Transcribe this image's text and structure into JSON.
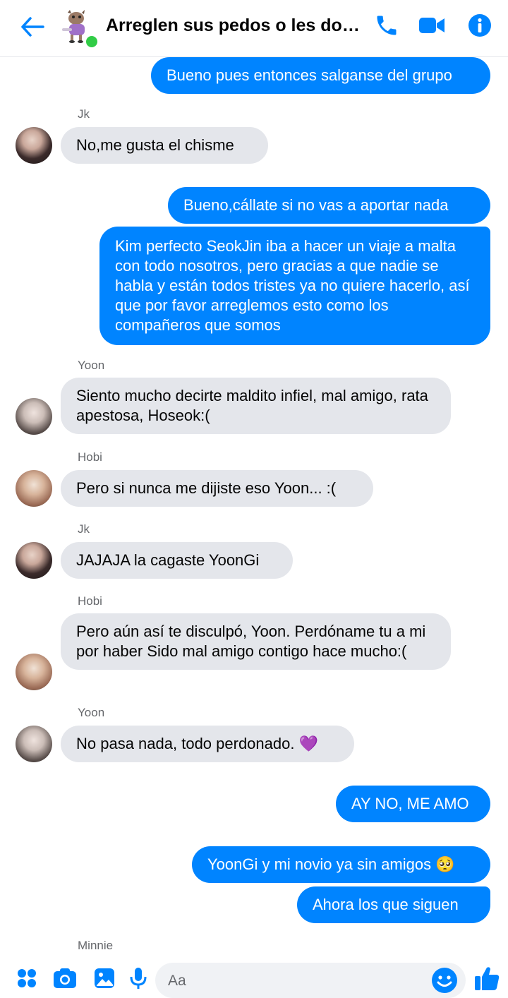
{
  "header": {
    "title": "Arreglen sus pedos o les doy en...",
    "back_icon": "arrow-left-icon",
    "call_icon": "phone-icon",
    "video_icon": "video-camera-icon",
    "info_icon": "info-icon",
    "accent": "#0084ff",
    "online_color": "#31cc46"
  },
  "messages": [
    {
      "dir": "out",
      "text": "Bueno pues entonces salganse del grupo"
    },
    {
      "dir": "in",
      "sender": "Jk",
      "text": "No,me gusta el chisme"
    },
    {
      "dir": "out",
      "text": "Bueno,cállate si no vas a aportar nada"
    },
    {
      "dir": "out",
      "text": "Kim perfecto SeokJin iba a hacer un viaje a malta con todo nosotros, pero gracias a que nadie se habla y están todos tristes ya no quiere hacerlo, así que por favor arreglemos esto como los compañeros que somos"
    },
    {
      "dir": "in",
      "sender": "Yoon",
      "text": "Siento mucho decirte maldito infiel, mal amigo, rata apestosa, Hoseok:("
    },
    {
      "dir": "in",
      "sender": "Hobi",
      "text": "Pero si nunca me dijiste eso Yoon... :("
    },
    {
      "dir": "in",
      "sender": "Jk",
      "text": "JAJAJA la cagaste YoonGi"
    },
    {
      "dir": "in",
      "sender": "Hobi",
      "text": "Pero aún así te disculpó, Yoon. Perdóname tu a mi por haber Sido mal amigo contigo hace mucho:("
    },
    {
      "dir": "in",
      "sender": "Yoon",
      "text": "No pasa nada, todo perdonado. 💜"
    },
    {
      "dir": "out",
      "text": "AY NO, ME AMO"
    },
    {
      "dir": "out",
      "text": "YoonGi y mi novio ya sin amigos 🥺"
    },
    {
      "dir": "out",
      "text": "Ahora los que siguen"
    }
  ],
  "typing_sender": "Minnie",
  "composer": {
    "placeholder": "Aa",
    "menu_icon": "four-dots-icon",
    "camera_icon": "camera-icon",
    "gallery_icon": "image-icon",
    "mic_icon": "microphone-icon",
    "emoji_icon": "smiley-icon",
    "like_icon": "thumbs-up-icon"
  }
}
